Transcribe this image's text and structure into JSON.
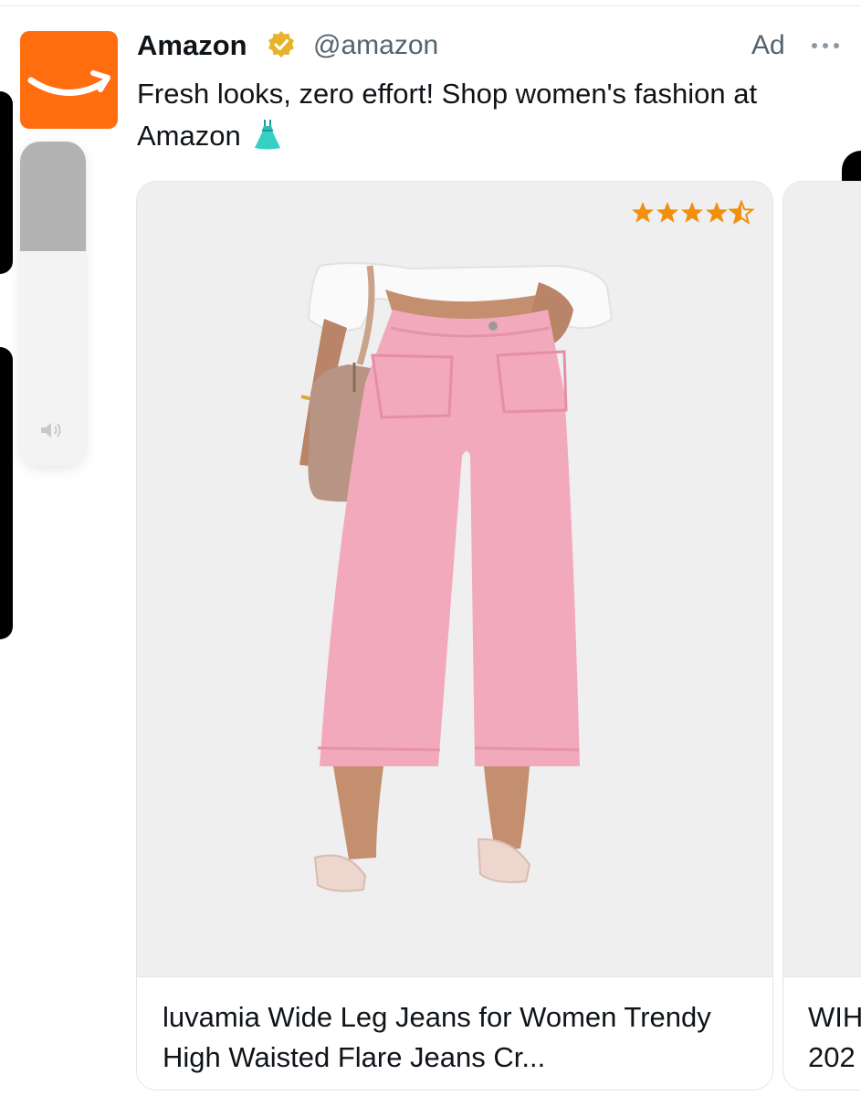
{
  "post": {
    "display_name": "Amazon",
    "handle": "@amazon",
    "ad_label": "Ad",
    "text": "Fresh looks, zero effort! Shop women's fashion at Amazon",
    "verified_icon": "verified-badge-icon",
    "more_icon": "more-dots-icon"
  },
  "volume": {
    "level": 0.34
  },
  "card": {
    "rating": 4.5,
    "rating_icon": "star-icon",
    "title": "luvamia Wide Leg Jeans for Women Trendy High Waisted Flare Jeans Cr..."
  },
  "next_card": {
    "title": "WIH\n202"
  },
  "colors": {
    "brand": "#ff6d0f",
    "verified": "#e8b32a",
    "star": "#f0900d",
    "pants": "#f3a9bc"
  }
}
